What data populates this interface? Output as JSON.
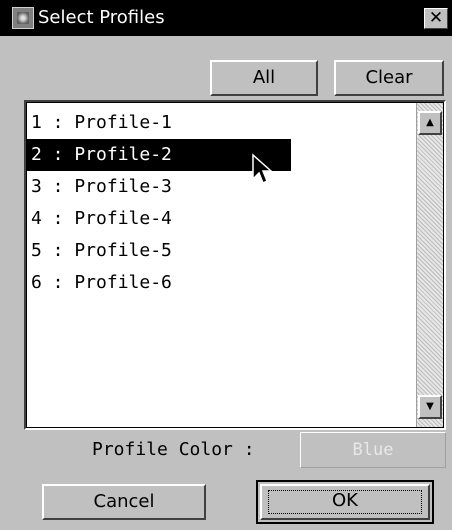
{
  "dialog": {
    "title": "Select Profiles",
    "close_label": "✕"
  },
  "buttons": {
    "all": "All",
    "clear": "Clear",
    "cancel": "Cancel",
    "ok": "OK"
  },
  "profiles": {
    "items": [
      "1 : Profile-1",
      "2 : Profile-2",
      "3 : Profile-3",
      "4 : Profile-4",
      "5 : Profile-5",
      "6 : Profile-6"
    ],
    "selected_index": 1
  },
  "scrollbar": {
    "up_arrow": "▲",
    "down_arrow": "▼"
  },
  "profile_color": {
    "label": "Profile Color :",
    "value": "Blue"
  },
  "icons": {
    "app": "app-icon",
    "close": "close-icon",
    "cursor": "mouse-pointer-icon"
  }
}
